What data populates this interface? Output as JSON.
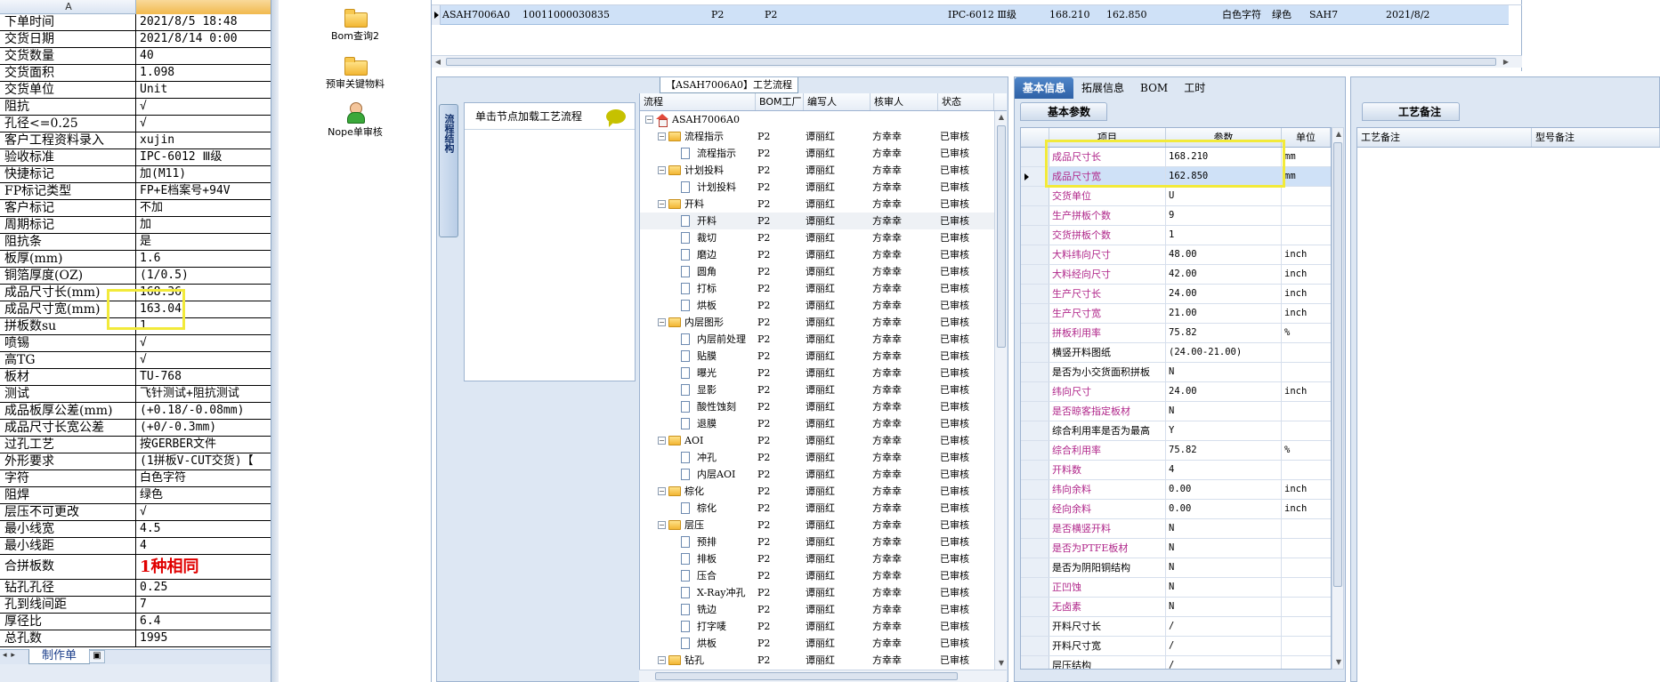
{
  "excel": {
    "col_a": "A",
    "rows": [
      {
        "k": "下单时间",
        "v": "2021/8/5 18:48"
      },
      {
        "k": "交货日期",
        "v": "2021/8/14 0:00"
      },
      {
        "k": "交货数量",
        "v": "40"
      },
      {
        "k": "交货面积",
        "v": "1.098"
      },
      {
        "k": "交货单位",
        "v": "Unit"
      },
      {
        "k": "阻抗",
        "v": "√"
      },
      {
        "k": "孔径<=0.25",
        "v": "√"
      },
      {
        "k": "客户工程资料录入",
        "v": "xujin"
      },
      {
        "k": "验收标准",
        "v": "IPC-6012 Ⅲ级"
      },
      {
        "k": "快捷标记",
        "v": "加(M11)"
      },
      {
        "k": "FP标记类型",
        "v": "FP+E档案号+94V"
      },
      {
        "k": "客户标记",
        "v": "不加"
      },
      {
        "k": "周期标记",
        "v": "加"
      },
      {
        "k": "阻抗条",
        "v": "是"
      },
      {
        "k": "板厚(mm)",
        "v": "1.6"
      },
      {
        "k": "铜箔厚度(OZ)",
        "v": "(1/0.5)"
      },
      {
        "k": "成品尺寸长(mm)",
        "v": "168.36"
      },
      {
        "k": "成品尺寸宽(mm)",
        "v": "163.04"
      },
      {
        "k": "拼板数su",
        "v": "1"
      },
      {
        "k": "喷锡",
        "v": "√"
      },
      {
        "k": "高TG",
        "v": "√"
      },
      {
        "k": "板材",
        "v": "TU-768"
      },
      {
        "k": "测试",
        "v": "飞针测试+阻抗测试"
      },
      {
        "k": "成品板厚公差(mm)",
        "v": "(+0.18/-0.08mm)"
      },
      {
        "k": "成品尺寸长宽公差",
        "v": "(+0/-0.3mm)"
      },
      {
        "k": "过孔工艺",
        "v": "按GERBER文件"
      },
      {
        "k": "外形要求",
        "v": "(1拼板V-CUT交货)【"
      },
      {
        "k": "字符",
        "v": "白色字符"
      },
      {
        "k": "阻焊",
        "v": "绿色"
      },
      {
        "k": "层压不可更改",
        "v": "√"
      },
      {
        "k": "最小线宽",
        "v": "4.5"
      },
      {
        "k": "最小线距",
        "v": "4"
      },
      {
        "k": "合拼板数",
        "v": "1种相同",
        "red": true
      },
      {
        "k": "钻孔孔径",
        "v": "0.25"
      },
      {
        "k": "孔到线间距",
        "v": "7"
      },
      {
        "k": "厚径比",
        "v": "6.4"
      },
      {
        "k": "总孔数",
        "v": "1995"
      }
    ],
    "sheet_nav": "◂ ▸",
    "sheet_tab": "制作单",
    "new_tab_icon": "sheet-add-icon"
  },
  "nav": {
    "items": [
      {
        "label": "Bom查询2",
        "icon": "folder-icon"
      },
      {
        "label": "预审关键物料",
        "icon": "folder-icon"
      },
      {
        "label": "Nope单审核",
        "icon": "user-icon"
      }
    ]
  },
  "topgrid": {
    "row": [
      "ASAH7006A0",
      "10011000030835",
      "P2",
      "P2",
      "IPC-6012 Ⅲ级",
      "168.210",
      "162.850",
      "白色字符",
      "绿色",
      "SAH7",
      "2021/8/2"
    ]
  },
  "process": {
    "title": "【ASAH7006A0】工艺流程",
    "side_tab": "流程结构",
    "load_hint": "单击节点加载工艺流程",
    "columns": [
      "流程",
      "BOM工厂",
      "编写人",
      "核审人",
      "状态"
    ],
    "rows": [
      {
        "name": "ASAH7006A0",
        "level": 0,
        "type": "root"
      },
      {
        "name": "流程指示",
        "level": 1,
        "type": "folder"
      },
      {
        "name": "流程指示",
        "level": 2,
        "type": "doc"
      },
      {
        "name": "计划投料",
        "level": 1,
        "type": "folder"
      },
      {
        "name": "计划投料",
        "level": 2,
        "type": "doc"
      },
      {
        "name": "开料",
        "level": 1,
        "type": "folder"
      },
      {
        "name": "开料",
        "level": 2,
        "type": "doc",
        "hover": true
      },
      {
        "name": "裁切",
        "level": 2,
        "type": "doc"
      },
      {
        "name": "磨边",
        "level": 2,
        "type": "doc"
      },
      {
        "name": "圆角",
        "level": 2,
        "type": "doc"
      },
      {
        "name": "打标",
        "level": 2,
        "type": "doc"
      },
      {
        "name": "烘板",
        "level": 2,
        "type": "doc"
      },
      {
        "name": "内层图形",
        "level": 1,
        "type": "folder"
      },
      {
        "name": "内层前处理",
        "level": 2,
        "type": "doc"
      },
      {
        "name": "贴膜",
        "level": 2,
        "type": "doc"
      },
      {
        "name": "曝光",
        "level": 2,
        "type": "doc"
      },
      {
        "name": "显影",
        "level": 2,
        "type": "doc"
      },
      {
        "name": "酸性蚀刻",
        "level": 2,
        "type": "doc"
      },
      {
        "name": "退膜",
        "level": 2,
        "type": "doc"
      },
      {
        "name": "AOI",
        "level": 1,
        "type": "folder"
      },
      {
        "name": "冲孔",
        "level": 2,
        "type": "doc"
      },
      {
        "name": "内层AOI",
        "level": 2,
        "type": "doc"
      },
      {
        "name": "棕化",
        "level": 1,
        "type": "folder"
      },
      {
        "name": "棕化",
        "level": 2,
        "type": "doc"
      },
      {
        "name": "层压",
        "level": 1,
        "type": "folder"
      },
      {
        "name": "预排",
        "level": 2,
        "type": "doc"
      },
      {
        "name": "排板",
        "level": 2,
        "type": "doc"
      },
      {
        "name": "压合",
        "level": 2,
        "type": "doc"
      },
      {
        "name": "X-Ray冲孔",
        "level": 2,
        "type": "doc"
      },
      {
        "name": "铣边",
        "level": 2,
        "type": "doc"
      },
      {
        "name": "打字唛",
        "level": 2,
        "type": "doc"
      },
      {
        "name": "烘板",
        "level": 2,
        "type": "doc"
      },
      {
        "name": "钻孔",
        "level": 1,
        "type": "folder"
      }
    ],
    "bom": "P2",
    "writer": "谭丽红",
    "reviewer": "方幸幸",
    "status": "已审核"
  },
  "info": {
    "tabs": [
      "基本信息",
      "拓展信息",
      "BOM",
      "工时"
    ],
    "subtab": "基本参数",
    "columns": [
      "项目",
      "参数",
      "单位"
    ],
    "rows": [
      {
        "k": "成品尺寸长",
        "v": "168.210",
        "u": "mm",
        "pink": true
      },
      {
        "k": "成品尺寸宽",
        "v": "162.850",
        "u": "mm",
        "pink": true,
        "sel": true
      },
      {
        "k": "交货单位",
        "v": "U",
        "u": "",
        "pink": true
      },
      {
        "k": "生产拼板个数",
        "v": "9",
        "u": "",
        "pink": true
      },
      {
        "k": "交货拼板个数",
        "v": "1",
        "u": "",
        "pink": true
      },
      {
        "k": "大料纬向尺寸",
        "v": "48.00",
        "u": "inch",
        "pink": true
      },
      {
        "k": "大料经向尺寸",
        "v": "42.00",
        "u": "inch",
        "pink": true
      },
      {
        "k": "生产尺寸长",
        "v": "24.00",
        "u": "inch",
        "pink": true
      },
      {
        "k": "生产尺寸宽",
        "v": "21.00",
        "u": "inch",
        "pink": true
      },
      {
        "k": "拼板利用率",
        "v": "75.82",
        "u": "%",
        "pink": true
      },
      {
        "k": "横竖开料图纸",
        "v": "(24.00-21.00)",
        "u": "",
        "pink": false
      },
      {
        "k": "是否为小交货面积拼板",
        "v": "N",
        "u": "",
        "pink": false
      },
      {
        "k": "纬向尺寸",
        "v": "24.00",
        "u": "inch",
        "pink": true
      },
      {
        "k": "是否晾客指定板材",
        "v": "N",
        "u": "",
        "pink": true
      },
      {
        "k": "综合利用率是否为最高",
        "v": "Y",
        "u": "",
        "pink": false
      },
      {
        "k": "综合利用率",
        "v": "75.82",
        "u": "%",
        "pink": true
      },
      {
        "k": "开料数",
        "v": "4",
        "u": "",
        "pink": true
      },
      {
        "k": "纬向余料",
        "v": "0.00",
        "u": "inch",
        "pink": true
      },
      {
        "k": "经向余料",
        "v": "0.00",
        "u": "inch",
        "pink": true
      },
      {
        "k": "是否横竖开料",
        "v": "N",
        "u": "",
        "pink": true
      },
      {
        "k": "是否为PTFE板材",
        "v": "N",
        "u": "",
        "pink": true
      },
      {
        "k": "是否为阴阳铜结构",
        "v": "N",
        "u": "",
        "pink": false
      },
      {
        "k": "正凹蚀",
        "v": "N",
        "u": "",
        "pink": true
      },
      {
        "k": "无卤素",
        "v": "N",
        "u": "",
        "pink": true
      },
      {
        "k": "开料尺寸长",
        "v": "/",
        "u": "",
        "pink": false
      },
      {
        "k": "开料尺寸宽",
        "v": "/",
        "u": "",
        "pink": false
      },
      {
        "k": "层压结构",
        "v": "/",
        "u": "",
        "pink": false
      }
    ]
  },
  "notes": {
    "subtab": "工艺备注",
    "columns": [
      "工艺备注",
      "型号备注"
    ]
  },
  "colors": {
    "highlight": "#f2ea3a",
    "selection": "#cfe1f7",
    "pink_label": "#b0268a",
    "tab_active": "#2e61a6"
  }
}
